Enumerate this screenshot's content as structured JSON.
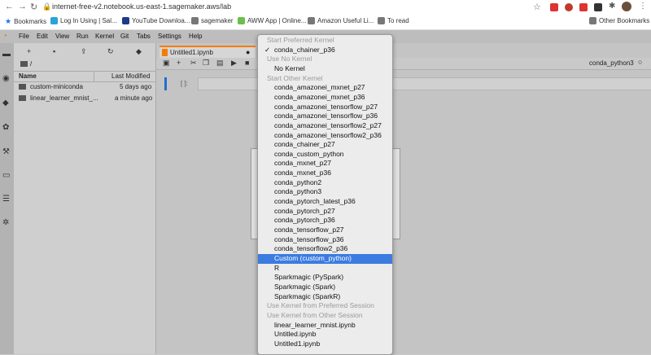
{
  "browser": {
    "url": "internet-free-v2.notebook.us-east-1.sagemaker.aws/lab",
    "bookmarks": [
      "Bookmarks",
      "Log In Using | Sal...",
      "YouTube Downloa...",
      "sagemaker",
      "AWW App | Online...",
      "Amazon Useful Li...",
      "To read"
    ],
    "other_bookmarks": "Other Bookmarks"
  },
  "menu": [
    "File",
    "Edit",
    "View",
    "Run",
    "Kernel",
    "Git",
    "Tabs",
    "Settings",
    "Help"
  ],
  "filebrowser": {
    "path": "/",
    "col_name": "Name",
    "col_modified": "Last Modified",
    "files": [
      {
        "name": "custom-miniconda",
        "modified": "5 days ago"
      },
      {
        "name": "linear_learner_mnist_...",
        "modified": "a minute ago"
      }
    ]
  },
  "notebook": {
    "tab_title": "Untitled1.ipynb",
    "kernel_name": "conda_python3",
    "prompt": "[ ]:"
  },
  "dropdown": {
    "items": [
      {
        "text": "Start Preferred Kernel",
        "kind": "header"
      },
      {
        "text": "conda_chainer_p36",
        "kind": "item",
        "checked": true
      },
      {
        "text": "Use No Kernel",
        "kind": "header"
      },
      {
        "text": "No Kernel",
        "kind": "item"
      },
      {
        "text": "Start Other Kernel",
        "kind": "header"
      },
      {
        "text": "conda_amazonei_mxnet_p27",
        "kind": "item"
      },
      {
        "text": "conda_amazonei_mxnet_p36",
        "kind": "item"
      },
      {
        "text": "conda_amazonei_tensorflow_p27",
        "kind": "item"
      },
      {
        "text": "conda_amazonei_tensorflow_p36",
        "kind": "item"
      },
      {
        "text": "conda_amazonei_tensorflow2_p27",
        "kind": "item"
      },
      {
        "text": "conda_amazonei_tensorflow2_p36",
        "kind": "item"
      },
      {
        "text": "conda_chainer_p27",
        "kind": "item"
      },
      {
        "text": "conda_custom_python",
        "kind": "item"
      },
      {
        "text": "conda_mxnet_p27",
        "kind": "item"
      },
      {
        "text": "conda_mxnet_p36",
        "kind": "item"
      },
      {
        "text": "conda_python2",
        "kind": "item"
      },
      {
        "text": "conda_python3",
        "kind": "item"
      },
      {
        "text": "conda_pytorch_latest_p36",
        "kind": "item"
      },
      {
        "text": "conda_pytorch_p27",
        "kind": "item"
      },
      {
        "text": "conda_pytorch_p36",
        "kind": "item"
      },
      {
        "text": "conda_tensorflow_p27",
        "kind": "item"
      },
      {
        "text": "conda_tensorflow_p36",
        "kind": "item"
      },
      {
        "text": "conda_tensorflow2_p36",
        "kind": "item"
      },
      {
        "text": "Custom (custom_python)",
        "kind": "item",
        "selected": true
      },
      {
        "text": "R",
        "kind": "item"
      },
      {
        "text": "Sparkmagic (PySpark)",
        "kind": "item"
      },
      {
        "text": "Sparkmagic (Spark)",
        "kind": "item"
      },
      {
        "text": "Sparkmagic (SparkR)",
        "kind": "item"
      },
      {
        "text": "Use Kernel from Preferred Session",
        "kind": "header"
      },
      {
        "text": "Use Kernel from Other Session",
        "kind": "header"
      },
      {
        "text": "linear_learner_mnist.ipynb",
        "kind": "item"
      },
      {
        "text": "Untitled.ipynb",
        "kind": "item"
      },
      {
        "text": "Untitled1.ipynb",
        "kind": "item"
      }
    ]
  },
  "colors": {
    "accent": "#3c7be0",
    "tab_accent": "#f57c00",
    "cell_active": "#1f6fcf"
  },
  "icons": {
    "back": "arrow-left-icon",
    "forward": "arrow-right-icon",
    "reload": "reload-icon",
    "lock": "lock-icon",
    "star": "star-icon",
    "new_launcher": "plus-icon",
    "new_folder": "folder-plus-icon",
    "upload": "upload-icon",
    "refresh": "refresh-icon",
    "git": "git-icon"
  }
}
